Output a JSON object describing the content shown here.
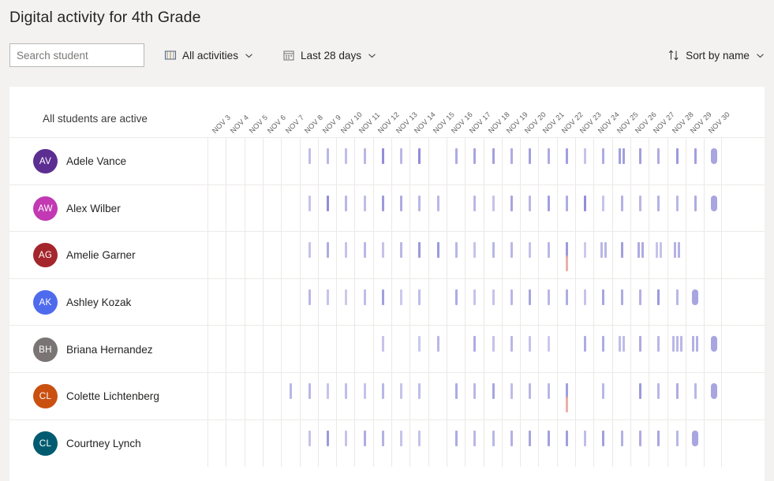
{
  "header": {
    "title": "Digital activity for 4th Grade"
  },
  "toolbar": {
    "search_placeholder": "Search student",
    "search_value": "",
    "activities_filter_label": "All activities",
    "activities_filter_icon": "book-icon",
    "date_range_label": "Last 28 days",
    "date_range_icon": "calendar-icon",
    "sort_label": "Sort by name",
    "sort_icon": "sort-arrows-icon",
    "chevron_icon": "chevron-down-icon"
  },
  "card": {
    "status_label": "All students are active",
    "columns": [
      "NOV 3",
      "NOV 4",
      "NOV 5",
      "NOV 6",
      "NOV 7",
      "NOV 8",
      "NOV 9",
      "NOV 10",
      "NOV 11",
      "NOV 12",
      "NOV 13",
      "NOV 14",
      "NOV 15",
      "NOV 16",
      "NOV 17",
      "NOV 18",
      "NOV 19",
      "NOV 20",
      "NOV 21",
      "NOV 22",
      "NOV 23",
      "NOV 24",
      "NOV 25",
      "NOV 26",
      "NOV 27",
      "NOV 28",
      "NOV 29",
      "NOV 30"
    ],
    "colors": {
      "page_background": "#f3f2f1",
      "card_background": "#ffffff",
      "grid_line": "#ebe9e7",
      "row_divider": "#edebe9",
      "activity_mark": "#8b87d6",
      "activity_mark_alt": "#e8a9a0",
      "label_text": "#605e5c"
    },
    "students": [
      {
        "name": "Adele Vance",
        "initials": "AV",
        "avatar_color": "#5c2e91",
        "activity": [
          {
            "col": 5,
            "n": 1,
            "op": 0.55
          },
          {
            "col": 6,
            "n": 1,
            "op": 0.6
          },
          {
            "col": 7,
            "n": 1,
            "op": 0.55
          },
          {
            "col": 8,
            "n": 1,
            "op": 0.6
          },
          {
            "col": 9,
            "n": 1,
            "op": 0.95
          },
          {
            "col": 10,
            "n": 1,
            "op": 0.6
          },
          {
            "col": 11,
            "n": 1,
            "op": 0.95
          },
          {
            "col": 13,
            "n": 1,
            "op": 0.7
          },
          {
            "col": 14,
            "n": 1,
            "op": 0.75
          },
          {
            "col": 15,
            "n": 1,
            "op": 0.8
          },
          {
            "col": 16,
            "n": 1,
            "op": 0.7
          },
          {
            "col": 17,
            "n": 1,
            "op": 0.8
          },
          {
            "col": 18,
            "n": 1,
            "op": 0.7
          },
          {
            "col": 19,
            "n": 1,
            "op": 0.8
          },
          {
            "col": 20,
            "n": 1,
            "op": 0.5
          },
          {
            "col": 21,
            "n": 1,
            "op": 0.7
          },
          {
            "col": 22,
            "n": 2,
            "op": 0.8
          },
          {
            "col": 23,
            "n": 1,
            "op": 0.8
          },
          {
            "col": 24,
            "n": 1,
            "op": 0.7
          },
          {
            "col": 25,
            "n": 1,
            "op": 0.85
          },
          {
            "col": 26,
            "n": 1,
            "op": 0.8
          },
          {
            "col": 27,
            "n": 1,
            "op": 0.75,
            "wide": true
          }
        ]
      },
      {
        "name": "Alex Wilber",
        "initials": "AW",
        "avatar_color": "#c239b3",
        "activity": [
          {
            "col": 5,
            "n": 1,
            "op": 0.5
          },
          {
            "col": 6,
            "n": 1,
            "op": 0.95
          },
          {
            "col": 7,
            "n": 1,
            "op": 0.6
          },
          {
            "col": 8,
            "n": 1,
            "op": 0.55
          },
          {
            "col": 9,
            "n": 1,
            "op": 0.85
          },
          {
            "col": 10,
            "n": 1,
            "op": 0.7
          },
          {
            "col": 11,
            "n": 1,
            "op": 0.6
          },
          {
            "col": 12,
            "n": 1,
            "op": 0.6
          },
          {
            "col": 14,
            "n": 1,
            "op": 0.6
          },
          {
            "col": 15,
            "n": 1,
            "op": 0.5
          },
          {
            "col": 16,
            "n": 1,
            "op": 0.75
          },
          {
            "col": 17,
            "n": 1,
            "op": 0.6
          },
          {
            "col": 18,
            "n": 1,
            "op": 0.8
          },
          {
            "col": 19,
            "n": 1,
            "op": 0.7
          },
          {
            "col": 20,
            "n": 1,
            "op": 0.95
          },
          {
            "col": 21,
            "n": 1,
            "op": 0.5
          },
          {
            "col": 22,
            "n": 1,
            "op": 0.65
          },
          {
            "col": 23,
            "n": 1,
            "op": 0.6
          },
          {
            "col": 24,
            "n": 1,
            "op": 0.65
          },
          {
            "col": 25,
            "n": 1,
            "op": 0.6
          },
          {
            "col": 26,
            "n": 1,
            "op": 0.7
          },
          {
            "col": 27,
            "n": 1,
            "op": 0.75,
            "wide": true
          }
        ]
      },
      {
        "name": "Amelie Garner",
        "initials": "AG",
        "avatar_color": "#a4262c",
        "activity": [
          {
            "col": 5,
            "n": 1,
            "op": 0.5
          },
          {
            "col": 6,
            "n": 1,
            "op": 0.7
          },
          {
            "col": 7,
            "n": 1,
            "op": 0.5
          },
          {
            "col": 8,
            "n": 1,
            "op": 0.6
          },
          {
            "col": 9,
            "n": 1,
            "op": 0.5
          },
          {
            "col": 10,
            "n": 1,
            "op": 0.6
          },
          {
            "col": 11,
            "n": 1,
            "op": 0.85
          },
          {
            "col": 12,
            "n": 1,
            "op": 0.85
          },
          {
            "col": 13,
            "n": 1,
            "op": 0.6
          },
          {
            "col": 14,
            "n": 1,
            "op": 0.5
          },
          {
            "col": 15,
            "n": 1,
            "op": 0.6
          },
          {
            "col": 16,
            "n": 1,
            "op": 0.6
          },
          {
            "col": 17,
            "n": 1,
            "op": 0.5
          },
          {
            "col": 18,
            "n": 1,
            "op": 0.6
          },
          {
            "col": 19,
            "n": 1,
            "op": 0.85
          },
          {
            "col": 19,
            "n": 1,
            "op": 0.9,
            "alt": true,
            "row2": true
          },
          {
            "col": 20,
            "n": 1,
            "op": 0.45
          },
          {
            "col": 21,
            "n": 2,
            "op": 0.6
          },
          {
            "col": 22,
            "n": 1,
            "op": 0.8
          },
          {
            "col": 23,
            "n": 2,
            "op": 0.7
          },
          {
            "col": 24,
            "n": 2,
            "op": 0.5
          },
          {
            "col": 25,
            "n": 2,
            "op": 0.65
          }
        ]
      },
      {
        "name": "Ashley Kozak",
        "initials": "AK",
        "avatar_color": "#4f6bed",
        "activity": [
          {
            "col": 5,
            "n": 1,
            "op": 0.6
          },
          {
            "col": 6,
            "n": 1,
            "op": 0.5
          },
          {
            "col": 7,
            "n": 1,
            "op": 0.45
          },
          {
            "col": 8,
            "n": 1,
            "op": 0.55
          },
          {
            "col": 9,
            "n": 1,
            "op": 0.8
          },
          {
            "col": 10,
            "n": 1,
            "op": 0.45
          },
          {
            "col": 11,
            "n": 1,
            "op": 0.55
          },
          {
            "col": 13,
            "n": 1,
            "op": 0.7
          },
          {
            "col": 14,
            "n": 1,
            "op": 0.5
          },
          {
            "col": 15,
            "n": 1,
            "op": 0.5
          },
          {
            "col": 16,
            "n": 1,
            "op": 0.6
          },
          {
            "col": 17,
            "n": 1,
            "op": 0.75
          },
          {
            "col": 18,
            "n": 1,
            "op": 0.6
          },
          {
            "col": 19,
            "n": 1,
            "op": 0.7
          },
          {
            "col": 20,
            "n": 1,
            "op": 0.5
          },
          {
            "col": 21,
            "n": 1,
            "op": 0.75
          },
          {
            "col": 22,
            "n": 1,
            "op": 0.7
          },
          {
            "col": 23,
            "n": 1,
            "op": 0.65
          },
          {
            "col": 24,
            "n": 1,
            "op": 0.85
          },
          {
            "col": 25,
            "n": 1,
            "op": 0.6
          },
          {
            "col": 26,
            "n": 1,
            "op": 0.75,
            "wide": true
          }
        ]
      },
      {
        "name": "Briana Hernandez",
        "initials": "BH",
        "avatar_color": "#7a7574",
        "activity": [
          {
            "col": 9,
            "n": 1,
            "op": 0.5
          },
          {
            "col": 11,
            "n": 1,
            "op": 0.45
          },
          {
            "col": 12,
            "n": 1,
            "op": 0.6
          },
          {
            "col": 14,
            "n": 1,
            "op": 0.7
          },
          {
            "col": 15,
            "n": 1,
            "op": 0.5
          },
          {
            "col": 16,
            "n": 1,
            "op": 0.6
          },
          {
            "col": 17,
            "n": 1,
            "op": 0.5
          },
          {
            "col": 18,
            "n": 1,
            "op": 0.45
          },
          {
            "col": 20,
            "n": 1,
            "op": 0.7
          },
          {
            "col": 21,
            "n": 1,
            "op": 0.7
          },
          {
            "col": 22,
            "n": 2,
            "op": 0.55
          },
          {
            "col": 23,
            "n": 1,
            "op": 0.7
          },
          {
            "col": 24,
            "n": 1,
            "op": 0.6
          },
          {
            "col": 25,
            "n": 3,
            "op": 0.6
          },
          {
            "col": 26,
            "n": 2,
            "op": 0.65
          },
          {
            "col": 27,
            "n": 1,
            "op": 0.75,
            "wide": true
          }
        ]
      },
      {
        "name": "Colette Lichtenberg",
        "initials": "CL",
        "avatar_color": "#ca5010",
        "activity": [
          {
            "col": 4,
            "n": 1,
            "op": 0.6
          },
          {
            "col": 5,
            "n": 1,
            "op": 0.6
          },
          {
            "col": 6,
            "n": 1,
            "op": 0.5
          },
          {
            "col": 7,
            "n": 1,
            "op": 0.55
          },
          {
            "col": 8,
            "n": 1,
            "op": 0.5
          },
          {
            "col": 9,
            "n": 1,
            "op": 0.6
          },
          {
            "col": 10,
            "n": 1,
            "op": 0.5
          },
          {
            "col": 11,
            "n": 1,
            "op": 0.55
          },
          {
            "col": 13,
            "n": 1,
            "op": 0.7
          },
          {
            "col": 14,
            "n": 1,
            "op": 0.6
          },
          {
            "col": 15,
            "n": 1,
            "op": 0.75
          },
          {
            "col": 16,
            "n": 1,
            "op": 0.55
          },
          {
            "col": 17,
            "n": 1,
            "op": 0.6
          },
          {
            "col": 18,
            "n": 1,
            "op": 0.6
          },
          {
            "col": 19,
            "n": 1,
            "op": 0.8
          },
          {
            "col": 19,
            "n": 1,
            "op": 0.9,
            "alt": true,
            "row2": true
          },
          {
            "col": 21,
            "n": 1,
            "op": 0.6
          },
          {
            "col": 23,
            "n": 1,
            "op": 0.85
          },
          {
            "col": 24,
            "n": 1,
            "op": 0.6
          },
          {
            "col": 25,
            "n": 1,
            "op": 0.7
          },
          {
            "col": 26,
            "n": 1,
            "op": 0.6
          },
          {
            "col": 27,
            "n": 1,
            "op": 0.75,
            "wide": true
          }
        ]
      },
      {
        "name": "Courtney Lynch",
        "initials": "CL",
        "avatar_color": "#005b70",
        "activity": [
          {
            "col": 5,
            "n": 1,
            "op": 0.5
          },
          {
            "col": 6,
            "n": 1,
            "op": 0.85
          },
          {
            "col": 7,
            "n": 1,
            "op": 0.5
          },
          {
            "col": 8,
            "n": 1,
            "op": 0.7
          },
          {
            "col": 9,
            "n": 1,
            "op": 0.65
          },
          {
            "col": 10,
            "n": 1,
            "op": 0.5
          },
          {
            "col": 11,
            "n": 1,
            "op": 0.5
          },
          {
            "col": 13,
            "n": 1,
            "op": 0.7
          },
          {
            "col": 14,
            "n": 1,
            "op": 0.6
          },
          {
            "col": 15,
            "n": 1,
            "op": 0.6
          },
          {
            "col": 16,
            "n": 1,
            "op": 0.65
          },
          {
            "col": 17,
            "n": 1,
            "op": 0.75
          },
          {
            "col": 18,
            "n": 1,
            "op": 0.8
          },
          {
            "col": 19,
            "n": 1,
            "op": 0.8
          },
          {
            "col": 20,
            "n": 1,
            "op": 0.55
          },
          {
            "col": 21,
            "n": 1,
            "op": 0.8
          },
          {
            "col": 22,
            "n": 1,
            "op": 0.65
          },
          {
            "col": 23,
            "n": 1,
            "op": 0.7
          },
          {
            "col": 24,
            "n": 1,
            "op": 0.75
          },
          {
            "col": 25,
            "n": 1,
            "op": 0.6
          },
          {
            "col": 26,
            "n": 1,
            "op": 0.75,
            "wide": true
          }
        ]
      }
    ]
  }
}
